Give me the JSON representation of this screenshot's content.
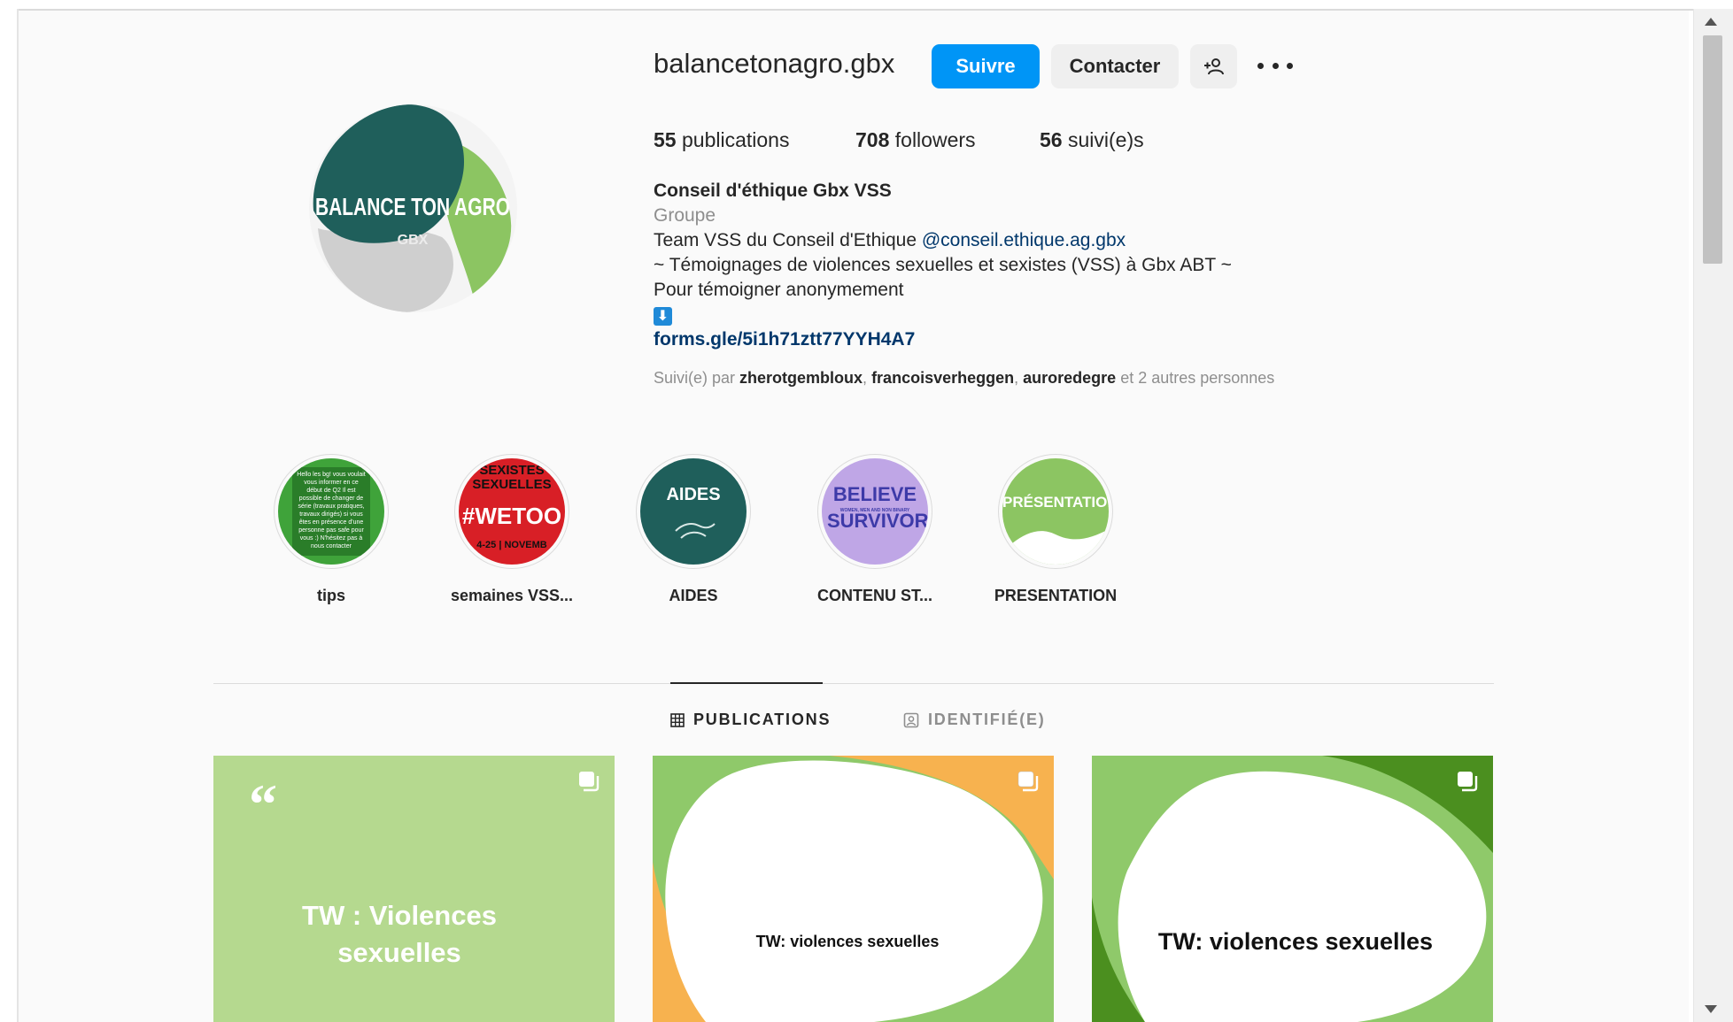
{
  "profile": {
    "username": "balancetonagro.gbx",
    "follow_label": "Suivre",
    "contact_label": "Contacter",
    "avatar_text": "BALANCE TON AGRO",
    "avatar_subtext": "GBX"
  },
  "stats": {
    "posts_count": "55",
    "posts_label": "publications",
    "followers_count": "708",
    "followers_label": "followers",
    "following_count": "56",
    "following_label": "suivi(e)s"
  },
  "bio": {
    "name": "Conseil d'éthique Gbx VSS",
    "category": "Groupe",
    "line1_prefix": "Team VSS du Conseil d'Ethique ",
    "line1_mention": "@conseil.ethique.ag.gbx",
    "line2": "~ Témoignages de violences sexuelles et sexistes (VSS) à Gbx ABT ~",
    "line3": "Pour témoigner anonymement",
    "arrow": "⬇",
    "link": "forms.gle/5i1h71ztt77YYH4A7"
  },
  "followed_by": {
    "prefix": "Suivi(e) par ",
    "users": [
      "zherotgembloux",
      "francoisverheggen",
      "auroredegre"
    ],
    "separator": ", ",
    "suffix": " et 2 autres personnes"
  },
  "highlights": [
    {
      "label": "tips",
      "cover_text": "Hello les bg! vous voulait vous informer en ce début de Q2 Il est possible de changer de série (travaux pratiques, travaux dirigés) si vous êtes en présence d'une personne pas safe pour vous :) N'hésitez pas à nous contacter"
    },
    {
      "label": "semaines VSS...",
      "cover_text_top": "SEXISTES SEXUELLES",
      "cover_text_main": "#WETOO",
      "cover_text_bottom": "4-25 | NOVEMB"
    },
    {
      "label": "AIDES",
      "cover_text": "AIDES"
    },
    {
      "label": "CONTENU ST...",
      "cover_text_main": "BELIEVE SURVIVORS",
      "cover_text_small": "WOMEN, MEN AND NON BINARY"
    },
    {
      "label": "PRESENTATION",
      "cover_text": "PRÉSENTATION"
    }
  ],
  "tabs": {
    "posts_label": "PUBLICATIONS",
    "tagged_label": "IDENTIFIÉ(E)"
  },
  "posts": [
    {
      "text_quote": "“",
      "text": "TW : Violences sexuelles"
    },
    {
      "text": "TW: violences sexuelles"
    },
    {
      "text": "TW: violences sexuelles"
    }
  ],
  "colors": {
    "follow_blue": "#0095f6",
    "link_blue": "#00376b",
    "brand_dark_green": "#1f5f5b",
    "brand_light_green": "#8fc96a"
  }
}
